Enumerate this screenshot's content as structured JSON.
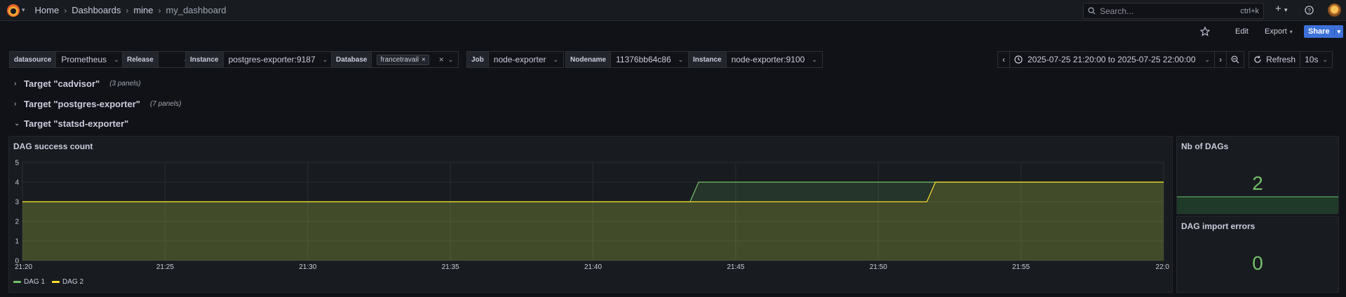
{
  "topbar": {
    "breadcrumbs": [
      "Home",
      "Dashboards",
      "mine",
      "my_dashboard"
    ],
    "search_placeholder": "Search...",
    "search_shortcut": "ctrl+k",
    "new_label": "+",
    "icons": [
      "grafana-logo",
      "search-icon",
      "plus-icon",
      "help-icon",
      "avatar"
    ]
  },
  "actions": {
    "edit_label": "Edit",
    "export_label": "Export",
    "share_label": "Share"
  },
  "variables": [
    {
      "label": "datasource",
      "value": "Prometheus"
    },
    {
      "label": "Release",
      "value": ""
    },
    {
      "label": "Instance",
      "value": "postgres-exporter:9187"
    },
    {
      "label": "Database",
      "value": "francetravail"
    },
    {
      "label": "Job",
      "value": "node-exporter"
    },
    {
      "label": "Nodename",
      "value": "11376bb64c86"
    },
    {
      "label": "Instance",
      "value": "node-exporter:9100"
    }
  ],
  "time_range": {
    "label": "2025-07-25 21:20:00 to 2025-07-25 22:00:00",
    "refresh_label": "Refresh",
    "refresh_interval": "10s"
  },
  "rows": [
    {
      "title": "Target \"cadvisor\"",
      "count": "(3 panels)",
      "collapsed": true
    },
    {
      "title": "Target \"postgres-exporter\"",
      "count": "(7 panels)",
      "collapsed": true
    },
    {
      "title": "Target \"statsd-exporter\"",
      "count": "",
      "collapsed": false
    }
  ],
  "panels": {
    "dag_success": {
      "title": "DAG success count"
    },
    "nb_dags": {
      "title": "Nb of DAGs",
      "value": "2",
      "color": "#73bf69"
    },
    "import_errors": {
      "title": "DAG import errors",
      "value": "0",
      "color": "#73bf69"
    }
  },
  "colors": {
    "dag1": "#73bf69",
    "dag2": "#fade2a",
    "accent": "#3d71d9"
  },
  "chart_data": {
    "type": "area",
    "title": "DAG success count",
    "x_ticks": [
      "21:20",
      "21:25",
      "21:30",
      "21:35",
      "21:40",
      "21:45",
      "21:50",
      "21:55",
      "22:0"
    ],
    "y_ticks": [
      "0",
      "1",
      "2",
      "3",
      "4",
      "5"
    ],
    "ylim": [
      0,
      5
    ],
    "xlim_minutes": [
      0,
      40
    ],
    "grid": true,
    "legend_placement": "bottom-left",
    "series": [
      {
        "name": "DAG 1",
        "color": "#73bf69",
        "points": [
          [
            0,
            3
          ],
          [
            23.4,
            3
          ],
          [
            23.7,
            4
          ],
          [
            40,
            4
          ]
        ]
      },
      {
        "name": "DAG 2",
        "color": "#fade2a",
        "points": [
          [
            0,
            3
          ],
          [
            31.7,
            3
          ],
          [
            32.0,
            4
          ],
          [
            40,
            4
          ]
        ]
      }
    ]
  }
}
